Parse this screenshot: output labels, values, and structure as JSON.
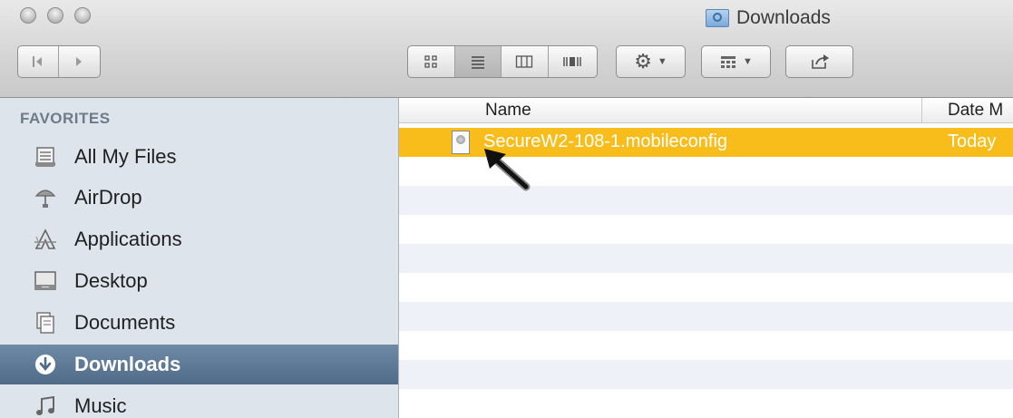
{
  "window": {
    "title": "Downloads"
  },
  "toolbar": {
    "nav_back_icon": "back-arrow-icon",
    "nav_forward_icon": "forward-arrow-icon",
    "view_modes": [
      "icon-view",
      "list-view",
      "column-view",
      "cover-flow-view"
    ],
    "active_view": "list-view",
    "action_icon": "gear-icon",
    "arrange_icon": "arrange-icon",
    "share_icon": "share-icon"
  },
  "sidebar": {
    "header": "FAVORITES",
    "items": [
      {
        "label": "All My Files",
        "icon": "all-files-icon"
      },
      {
        "label": "AirDrop",
        "icon": "airdrop-icon"
      },
      {
        "label": "Applications",
        "icon": "applications-icon"
      },
      {
        "label": "Desktop",
        "icon": "desktop-icon"
      },
      {
        "label": "Documents",
        "icon": "documents-icon"
      },
      {
        "label": "Downloads",
        "icon": "downloads-icon",
        "selected": true
      },
      {
        "label": "Music",
        "icon": "music-icon"
      }
    ]
  },
  "file_list": {
    "columns": [
      "Name",
      "Date M"
    ],
    "files": [
      {
        "name": "SecureW2-108-1.mobileconfig",
        "date": "Today",
        "selected": true
      }
    ]
  },
  "colors": {
    "selection": "#f8bd1b",
    "sidebar_background": "#dde4eb",
    "sidebar_selection": "#5a7694",
    "alt_row": "#eef2f8"
  }
}
